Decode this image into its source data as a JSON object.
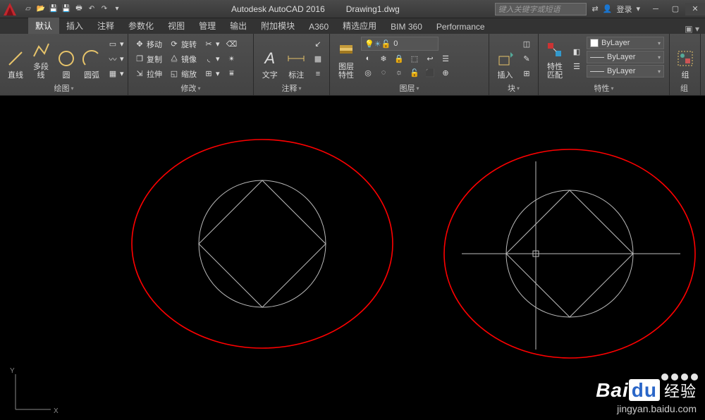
{
  "title": {
    "app": "Autodesk AutoCAD 2016",
    "doc": "Drawing1.dwg"
  },
  "search": {
    "placeholder": "键入关键字或短语"
  },
  "login": {
    "label": "登录"
  },
  "tabs": [
    "默认",
    "插入",
    "注释",
    "参数化",
    "视图",
    "管理",
    "输出",
    "附加模块",
    "A360",
    "精选应用",
    "BIM 360",
    "Performance"
  ],
  "panels": {
    "draw": {
      "label": "绘图",
      "btns": {
        "line": "直线",
        "pline": "多段线",
        "circle": "圆",
        "arc": "圆弧"
      }
    },
    "modify": {
      "label": "修改",
      "btns": {
        "move": "移动",
        "copy": "复制",
        "stretch": "拉伸",
        "rotate": "旋转",
        "mirror": "镜像",
        "scale": "缩放"
      }
    },
    "annot": {
      "label": "注释",
      "btns": {
        "text": "文字",
        "dim": "标注"
      }
    },
    "layer": {
      "label": "图层",
      "btns": {
        "props": "图层\n特性"
      },
      "current": "0"
    },
    "block": {
      "label": "块",
      "btns": {
        "insert": "插入"
      }
    },
    "props": {
      "label": "特性",
      "btns": {
        "match": "特性\n匹配"
      },
      "sel": [
        "ByLayer",
        "ByLayer",
        "ByLayer"
      ]
    },
    "group": {
      "label": "组",
      "btn": "组"
    }
  },
  "watermark": {
    "brand": "Baidu",
    "cn": "经验",
    "url": "jingyan.baidu.com"
  }
}
